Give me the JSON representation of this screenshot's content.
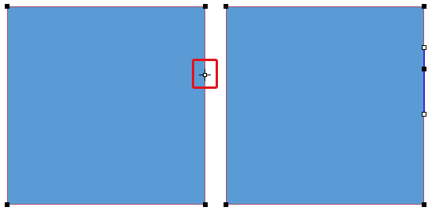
{
  "canvas": {
    "background": "#ffffff",
    "shape_fill": "#5b9bd5",
    "shape_border": "#a64f6a",
    "selected_edge_color": "#3b2bd1",
    "highlight_color": "#e0141c"
  },
  "left_shape": {
    "fill": "#5b9bd5",
    "state": "corner handles shown, cursor hovering right edge midpoint"
  },
  "right_shape": {
    "fill": "#5b9bd5",
    "state": "right edge segment selected with handles"
  },
  "icons": {
    "cursor": "crosshair-move-icon",
    "handle_solid": "solid-square-handle-icon",
    "handle_hollow": "hollow-square-handle-icon"
  }
}
